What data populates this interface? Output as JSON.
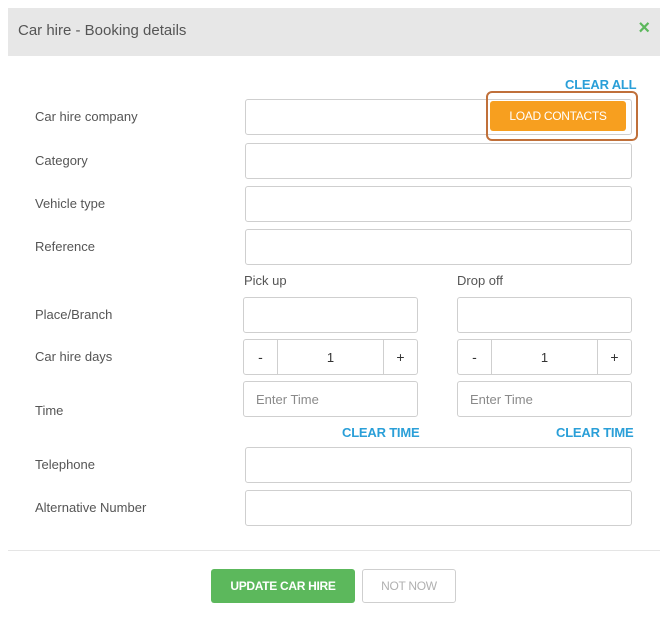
{
  "dialog": {
    "title": "Car hire - Booking details",
    "close_icon": "×"
  },
  "actions": {
    "clear_all": "CLEAR ALL",
    "load_contacts": "LOAD CONTACTS",
    "update": "UPDATE CAR HIRE",
    "not_now": "NOT NOW"
  },
  "fields": {
    "car_hire_company": {
      "label": "Car hire company",
      "value": ""
    },
    "category": {
      "label": "Category",
      "value": ""
    },
    "vehicle_type": {
      "label": "Vehicle type",
      "value": ""
    },
    "reference": {
      "label": "Reference",
      "value": ""
    },
    "place_branch": {
      "label": "Place/Branch"
    },
    "car_hire_days": {
      "label": "Car hire days"
    },
    "time": {
      "label": "Time"
    },
    "telephone": {
      "label": "Telephone",
      "value": ""
    },
    "alternative_number": {
      "label": "Alternative Number",
      "value": ""
    }
  },
  "pickup": {
    "heading": "Pick up",
    "place_value": "",
    "days": {
      "minus": "-",
      "value": "1",
      "plus": "+"
    },
    "time_placeholder": "Enter Time",
    "clear_time": "CLEAR TIME"
  },
  "dropoff": {
    "heading": "Drop off",
    "place_value": "",
    "days": {
      "minus": "-",
      "value": "1",
      "plus": "+"
    },
    "time_placeholder": "Enter Time",
    "clear_time": "CLEAR TIME"
  },
  "colors": {
    "accent_green": "#5cb85c",
    "accent_orange": "#f79f1f",
    "link_blue": "#2a9fd8",
    "highlight": "#c0703a"
  }
}
